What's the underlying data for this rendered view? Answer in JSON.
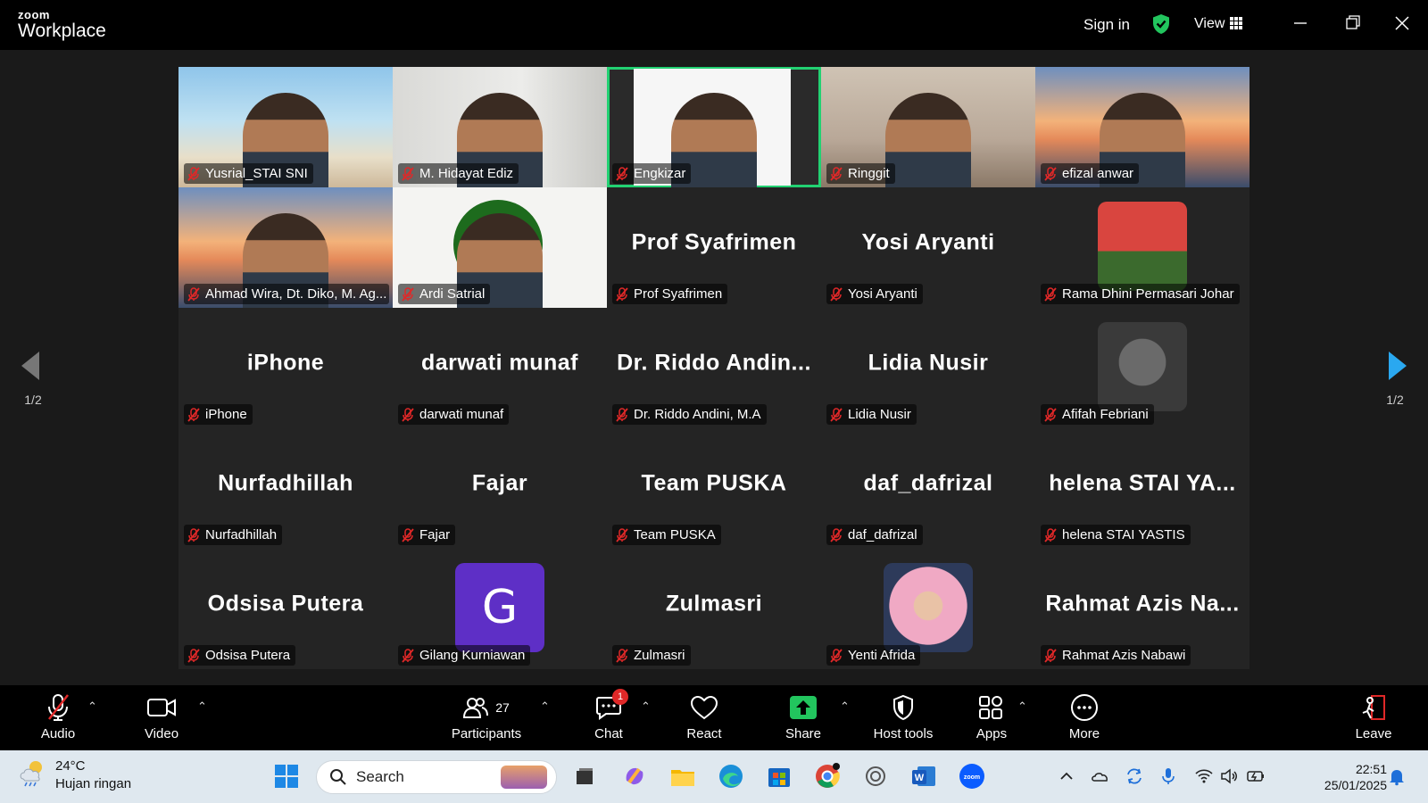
{
  "titlebar": {
    "brand_small": "zoom",
    "brand_big": "Workplace",
    "signin": "Sign in",
    "view": "View"
  },
  "gallery": {
    "page_left": "1/2",
    "page_right": "1/2",
    "tiles": [
      {
        "label": "Yusrial_STAI SNI",
        "type": "video-beach"
      },
      {
        "label": "M. Hidayat Ediz",
        "type": "video-stripes"
      },
      {
        "label": "Engkizar",
        "type": "video-doc",
        "active": true
      },
      {
        "label": "Ringgit",
        "type": "video-room"
      },
      {
        "label": "efizal anwar",
        "type": "video-bridge"
      },
      {
        "label": "Ahmad Wira, Dt. Diko, M. Ag...",
        "type": "video-bridge"
      },
      {
        "label": "Ardi Satrial",
        "type": "video-logo"
      },
      {
        "label": "Prof Syafrimen",
        "big": "Prof Syafrimen"
      },
      {
        "label": "Yosi Aryanti",
        "big": "Yosi Aryanti"
      },
      {
        "label": "Rama Dhini Permasari Johar",
        "type": "avatar-photo"
      },
      {
        "label": "iPhone",
        "big": "iPhone"
      },
      {
        "label": "darwati munaf",
        "big": "darwati munaf"
      },
      {
        "label": "Dr. Riddo Andini, M.A",
        "big": "Dr. Riddo Andin..."
      },
      {
        "label": "Lidia Nusir",
        "big": "Lidia Nusir"
      },
      {
        "label": "Afifah Febriani",
        "type": "avatar-gray"
      },
      {
        "label": "Nurfadhillah",
        "big": "Nurfadhillah"
      },
      {
        "label": "Fajar",
        "big": "Fajar"
      },
      {
        "label": "Team PUSKA",
        "big": "Team PUSKA"
      },
      {
        "label": "daf_dafrizal",
        "big": "daf_dafrizal"
      },
      {
        "label": "helena STAI YASTIS",
        "big": "helena STAI YA..."
      },
      {
        "label": "Odsisa Putera",
        "big": "Odsisa Putera"
      },
      {
        "label": "Gilang Kurniawan",
        "type": "avatar-letter",
        "letter": "G"
      },
      {
        "label": "Zulmasri",
        "big": "Zulmasri"
      },
      {
        "label": "Yenti Afrida",
        "type": "avatar-hijab"
      },
      {
        "label": "Rahmat Azis Nabawi",
        "big": "Rahmat Azis Na..."
      }
    ]
  },
  "toolbar": {
    "audio": "Audio",
    "video": "Video",
    "participants": "Participants",
    "participants_count": "27",
    "chat": "Chat",
    "chat_badge": "1",
    "react": "React",
    "share": "Share",
    "host_tools": "Host tools",
    "apps": "Apps",
    "more": "More",
    "leave": "Leave"
  },
  "taskbar": {
    "temp": "24°C",
    "weather": "Hujan ringan",
    "search_placeholder": "Search",
    "time": "22:51",
    "date": "25/01/2025"
  },
  "colors": {
    "active_border": "#22d172",
    "share_green": "#22c55e",
    "mic_off_red": "#e02828",
    "taskbar_bg": "#dfe8ef"
  }
}
